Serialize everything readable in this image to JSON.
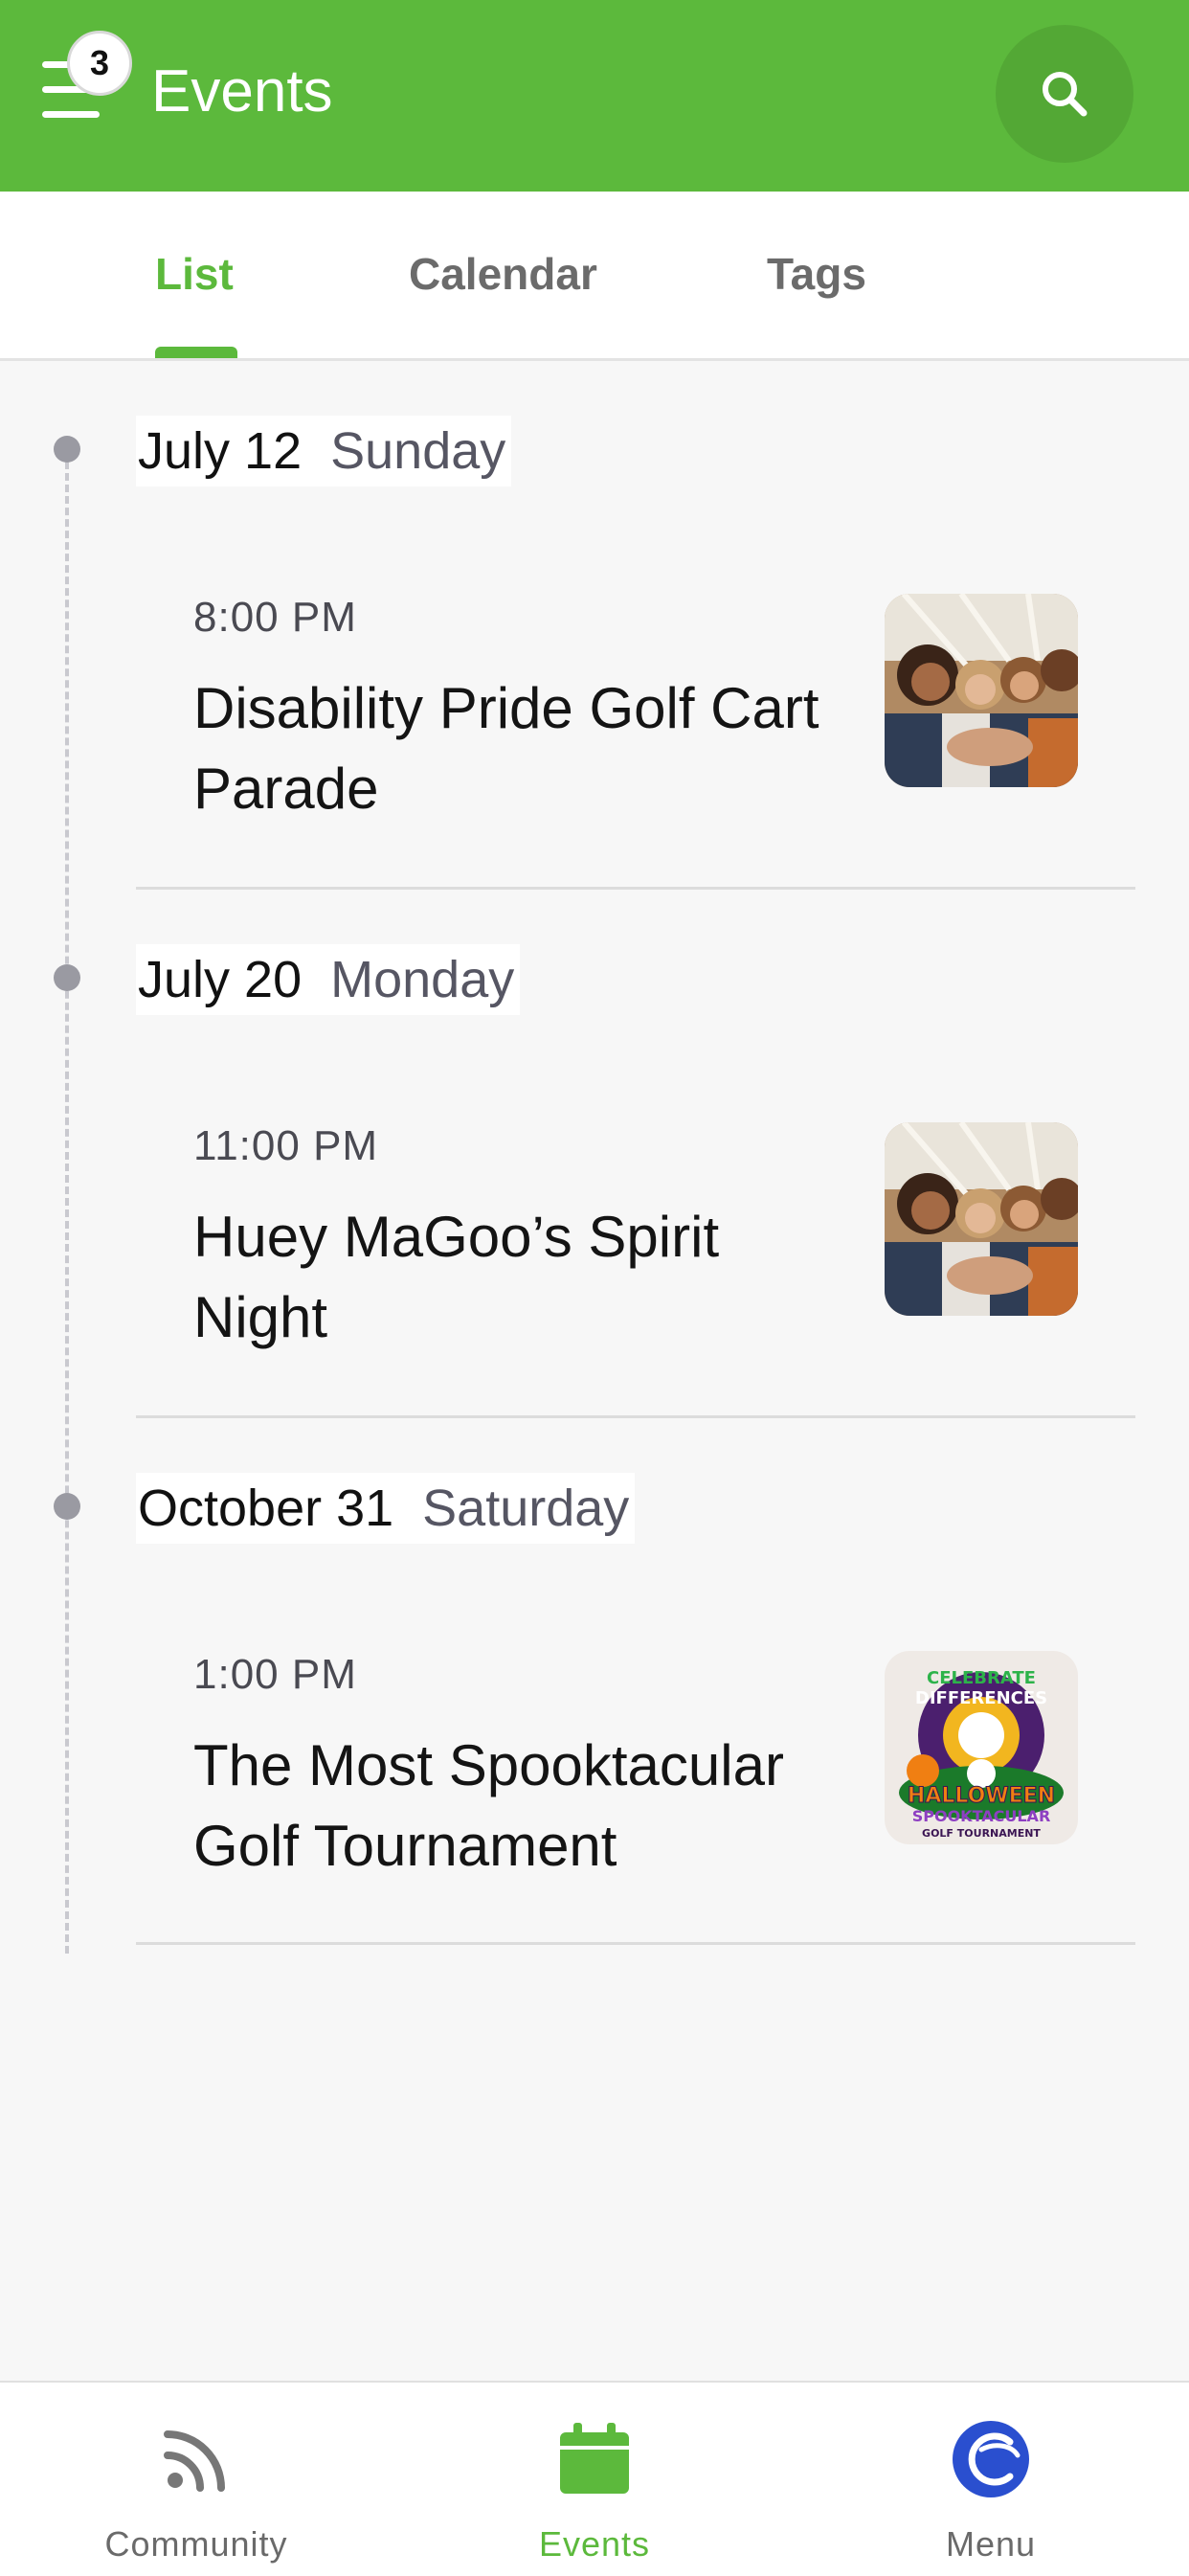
{
  "header": {
    "title": "Events",
    "notification_count": "3",
    "menu_icon": "hamburger-icon",
    "search_icon": "search-icon",
    "color": "#5cb93c"
  },
  "tabs": [
    {
      "label": "List",
      "active": true
    },
    {
      "label": "Calendar",
      "active": false
    },
    {
      "label": "Tags",
      "active": false
    }
  ],
  "events": [
    {
      "date": "July 12",
      "weekday": "Sunday",
      "time": "8:00 PM",
      "title": "Disability Pride Golf Cart Parade",
      "image": "group-photo"
    },
    {
      "date": "July 20",
      "weekday": "Monday",
      "time": "11:00 PM",
      "title": "Huey MaGoo’s Spirit Night",
      "image": "group-photo"
    },
    {
      "date": "October 31",
      "weekday": "Saturday",
      "time": "1:00 PM",
      "title": "The Most Spooktacular Golf Tournament",
      "image": "halloween-golf-logo",
      "image_text": [
        "CELEBRATE",
        "DIFFERENCES",
        "HALLOWEEN",
        "SPOOKTACULAR",
        "GOLF TOURNAMENT"
      ]
    }
  ],
  "bottom_nav": [
    {
      "label": "Community",
      "icon": "rss-icon",
      "active": false
    },
    {
      "label": "Events",
      "icon": "calendar-icon",
      "active": true
    },
    {
      "label": "Menu",
      "icon": "app-logo-icon",
      "active": false
    }
  ]
}
